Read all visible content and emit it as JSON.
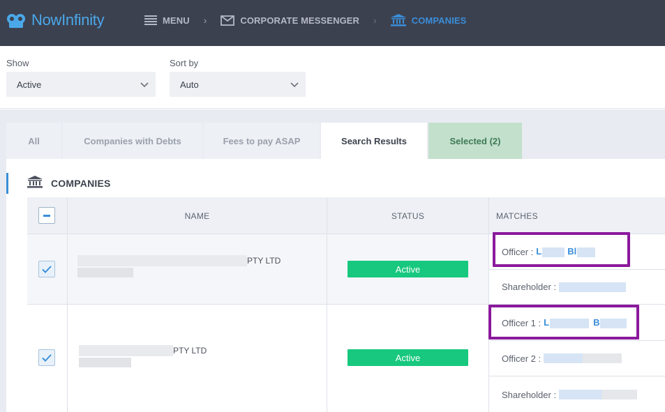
{
  "brand": {
    "name": "NowInfinity",
    "color": "#4aa8e8"
  },
  "breadcrumb": {
    "menu_label": "MENU",
    "messenger_label": "CORPORATE MESSENGER",
    "companies_label": "COMPANIES",
    "separator": "›"
  },
  "filters": {
    "show_label": "Show",
    "show_value": "Active",
    "sort_label": "Sort by",
    "sort_value": "Auto"
  },
  "tabs": [
    {
      "label": "All"
    },
    {
      "label": "Companies with Debts"
    },
    {
      "label": "Fees to pay ASAP"
    },
    {
      "label": "Search Results"
    },
    {
      "label": "Selected (2)"
    }
  ],
  "panel": {
    "title": "COMPANIES"
  },
  "table": {
    "columns": [
      "NAME",
      "STATUS",
      "MATCHES"
    ],
    "rows": [
      {
        "name_suffix": "PTY LTD",
        "status": "Active",
        "matches": [
          {
            "label": "Officer :",
            "value_prefix": "L",
            "value_mid": "Bl"
          },
          {
            "label": "Shareholder :"
          }
        ]
      },
      {
        "name_suffix": "PTY LTD",
        "status": "Active",
        "matches": [
          {
            "label": "Officer 1 :",
            "value_prefix": "L",
            "value_mid": "B"
          },
          {
            "label": "Officer 2 :"
          },
          {
            "label": "Shareholder :"
          }
        ]
      }
    ]
  },
  "colors": {
    "topbar": "#3c4150",
    "accent": "#3a8ed8",
    "status_active": "#17c87e",
    "highlight": "#8b1a9c",
    "selected_tab": "#c3e0cd"
  }
}
